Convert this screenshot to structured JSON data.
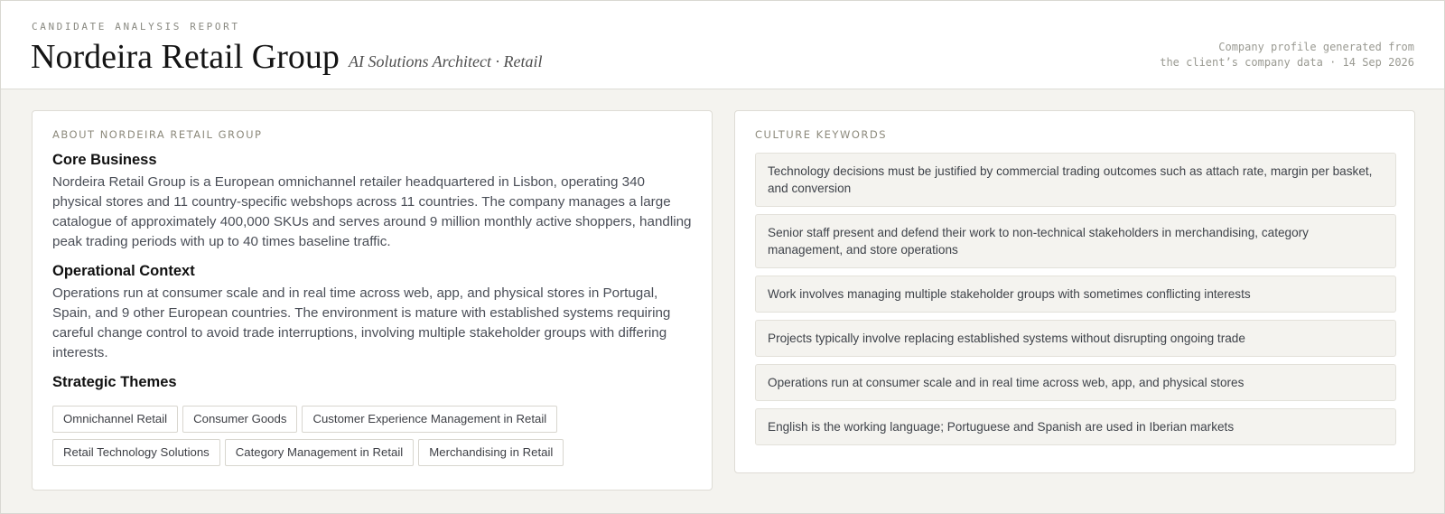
{
  "header": {
    "eyebrow": "CANDIDATE ANALYSIS REPORT",
    "title": "Nordeira Retail Group",
    "subtitle": "AI Solutions Architect · Retail",
    "meta_line1": "Company profile generated from",
    "meta_line2": "the client’s company data · 14 Sep 2026"
  },
  "about": {
    "label": "ABOUT NORDEIRA RETAIL GROUP",
    "core_business_title": "Core Business",
    "core_business_text": "Nordeira Retail Group is a European omnichannel retailer headquartered in Lisbon, operating 340 physical stores and 11 country-specific webshops across 11 countries. The company manages a large catalogue of approximately 400,000 SKUs and serves around 9 million monthly active shoppers, handling peak trading periods with up to 40 times baseline traffic.",
    "operational_title": "Operational Context",
    "operational_text": "Operations run at consumer scale and in real time across web, app, and physical stores in Portugal, Spain, and 9 other European countries. The environment is mature with established systems requiring careful change control to avoid trade interruptions, involving multiple stakeholder groups with differing interests.",
    "themes_title": "Strategic Themes",
    "themes": [
      "Omnichannel Retail",
      "Consumer Goods",
      "Customer Experience Management in Retail",
      "Retail Technology Solutions",
      "Category Management in Retail",
      "Merchandising in Retail"
    ]
  },
  "culture": {
    "label": "CULTURE KEYWORDS",
    "keywords": [
      "Technology decisions must be justified by commercial trading outcomes such as attach rate, margin per basket, and conversion",
      "Senior staff present and defend their work to non-technical stakeholders in merchandising, category management, and store operations",
      "Work involves managing multiple stakeholder groups with sometimes conflicting interests",
      "Projects typically involve replacing established systems without disrupting ongoing trade",
      "Operations run at consumer scale and in real time across web, app, and physical stores",
      "English is the working language; Portuguese and Spanish are used in Iberian markets"
    ]
  }
}
